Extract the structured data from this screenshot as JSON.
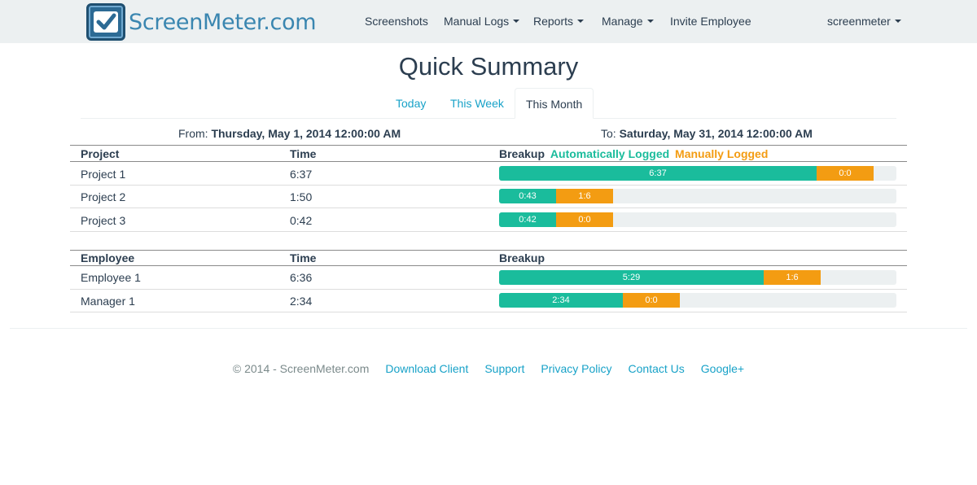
{
  "brand": {
    "name": "ScreenMeter.com",
    "logo_icon": "checkmark-icon"
  },
  "nav": {
    "screenshots": "Screenshots",
    "manual_logs": "Manual Logs",
    "reports": "Reports",
    "manage": "Manage",
    "invite": "Invite Employee",
    "user": "screenmeter"
  },
  "page_title": "Quick Summary",
  "tabs": {
    "today": "Today",
    "this_week": "This Week",
    "this_month": "This Month",
    "active": "This Month"
  },
  "range": {
    "from_label": "From:",
    "from_value": "Thursday, May 1, 2014 12:00:00 AM",
    "to_label": "To:",
    "to_value": "Saturday, May 31, 2014 12:00:00 AM"
  },
  "colors": {
    "auto": "#1abc9c",
    "manual": "#f39c12",
    "track": "#ecf0f1"
  },
  "projects": {
    "headers": {
      "name": "Project",
      "time": "Time",
      "breakup": "Breakup"
    },
    "legend": {
      "auto": "Automatically Logged",
      "manual": "Manually Logged"
    },
    "rows": [
      {
        "name": "Project 1",
        "time": "6:37",
        "auto_label": "6:37",
        "manual_label": "0:0",
        "auto_frac": 0.8,
        "manual_frac": 0.143
      },
      {
        "name": "Project 2",
        "time": "1:50",
        "auto_label": "0:43",
        "manual_label": "1:6",
        "auto_frac": 0.143,
        "manual_frac": 0.143
      },
      {
        "name": "Project 3",
        "time": "0:42",
        "auto_label": "0:42",
        "manual_label": "0:0",
        "auto_frac": 0.143,
        "manual_frac": 0.143
      }
    ]
  },
  "employees": {
    "headers": {
      "name": "Employee",
      "time": "Time",
      "breakup": "Breakup"
    },
    "rows": [
      {
        "name": "Employee 1",
        "time": "6:36",
        "auto_label": "5:29",
        "manual_label": "1:6",
        "auto_frac": 0.665,
        "manual_frac": 0.143
      },
      {
        "name": "Manager 1",
        "time": "2:34",
        "auto_label": "2:34",
        "manual_label": "0:0",
        "auto_frac": 0.311,
        "manual_frac": 0.143
      }
    ]
  },
  "footer": {
    "copyright": "© 2014 - ScreenMeter.com",
    "download": "Download Client",
    "support": "Support",
    "privacy": "Privacy Policy",
    "contact": "Contact Us",
    "google": "Google+"
  }
}
